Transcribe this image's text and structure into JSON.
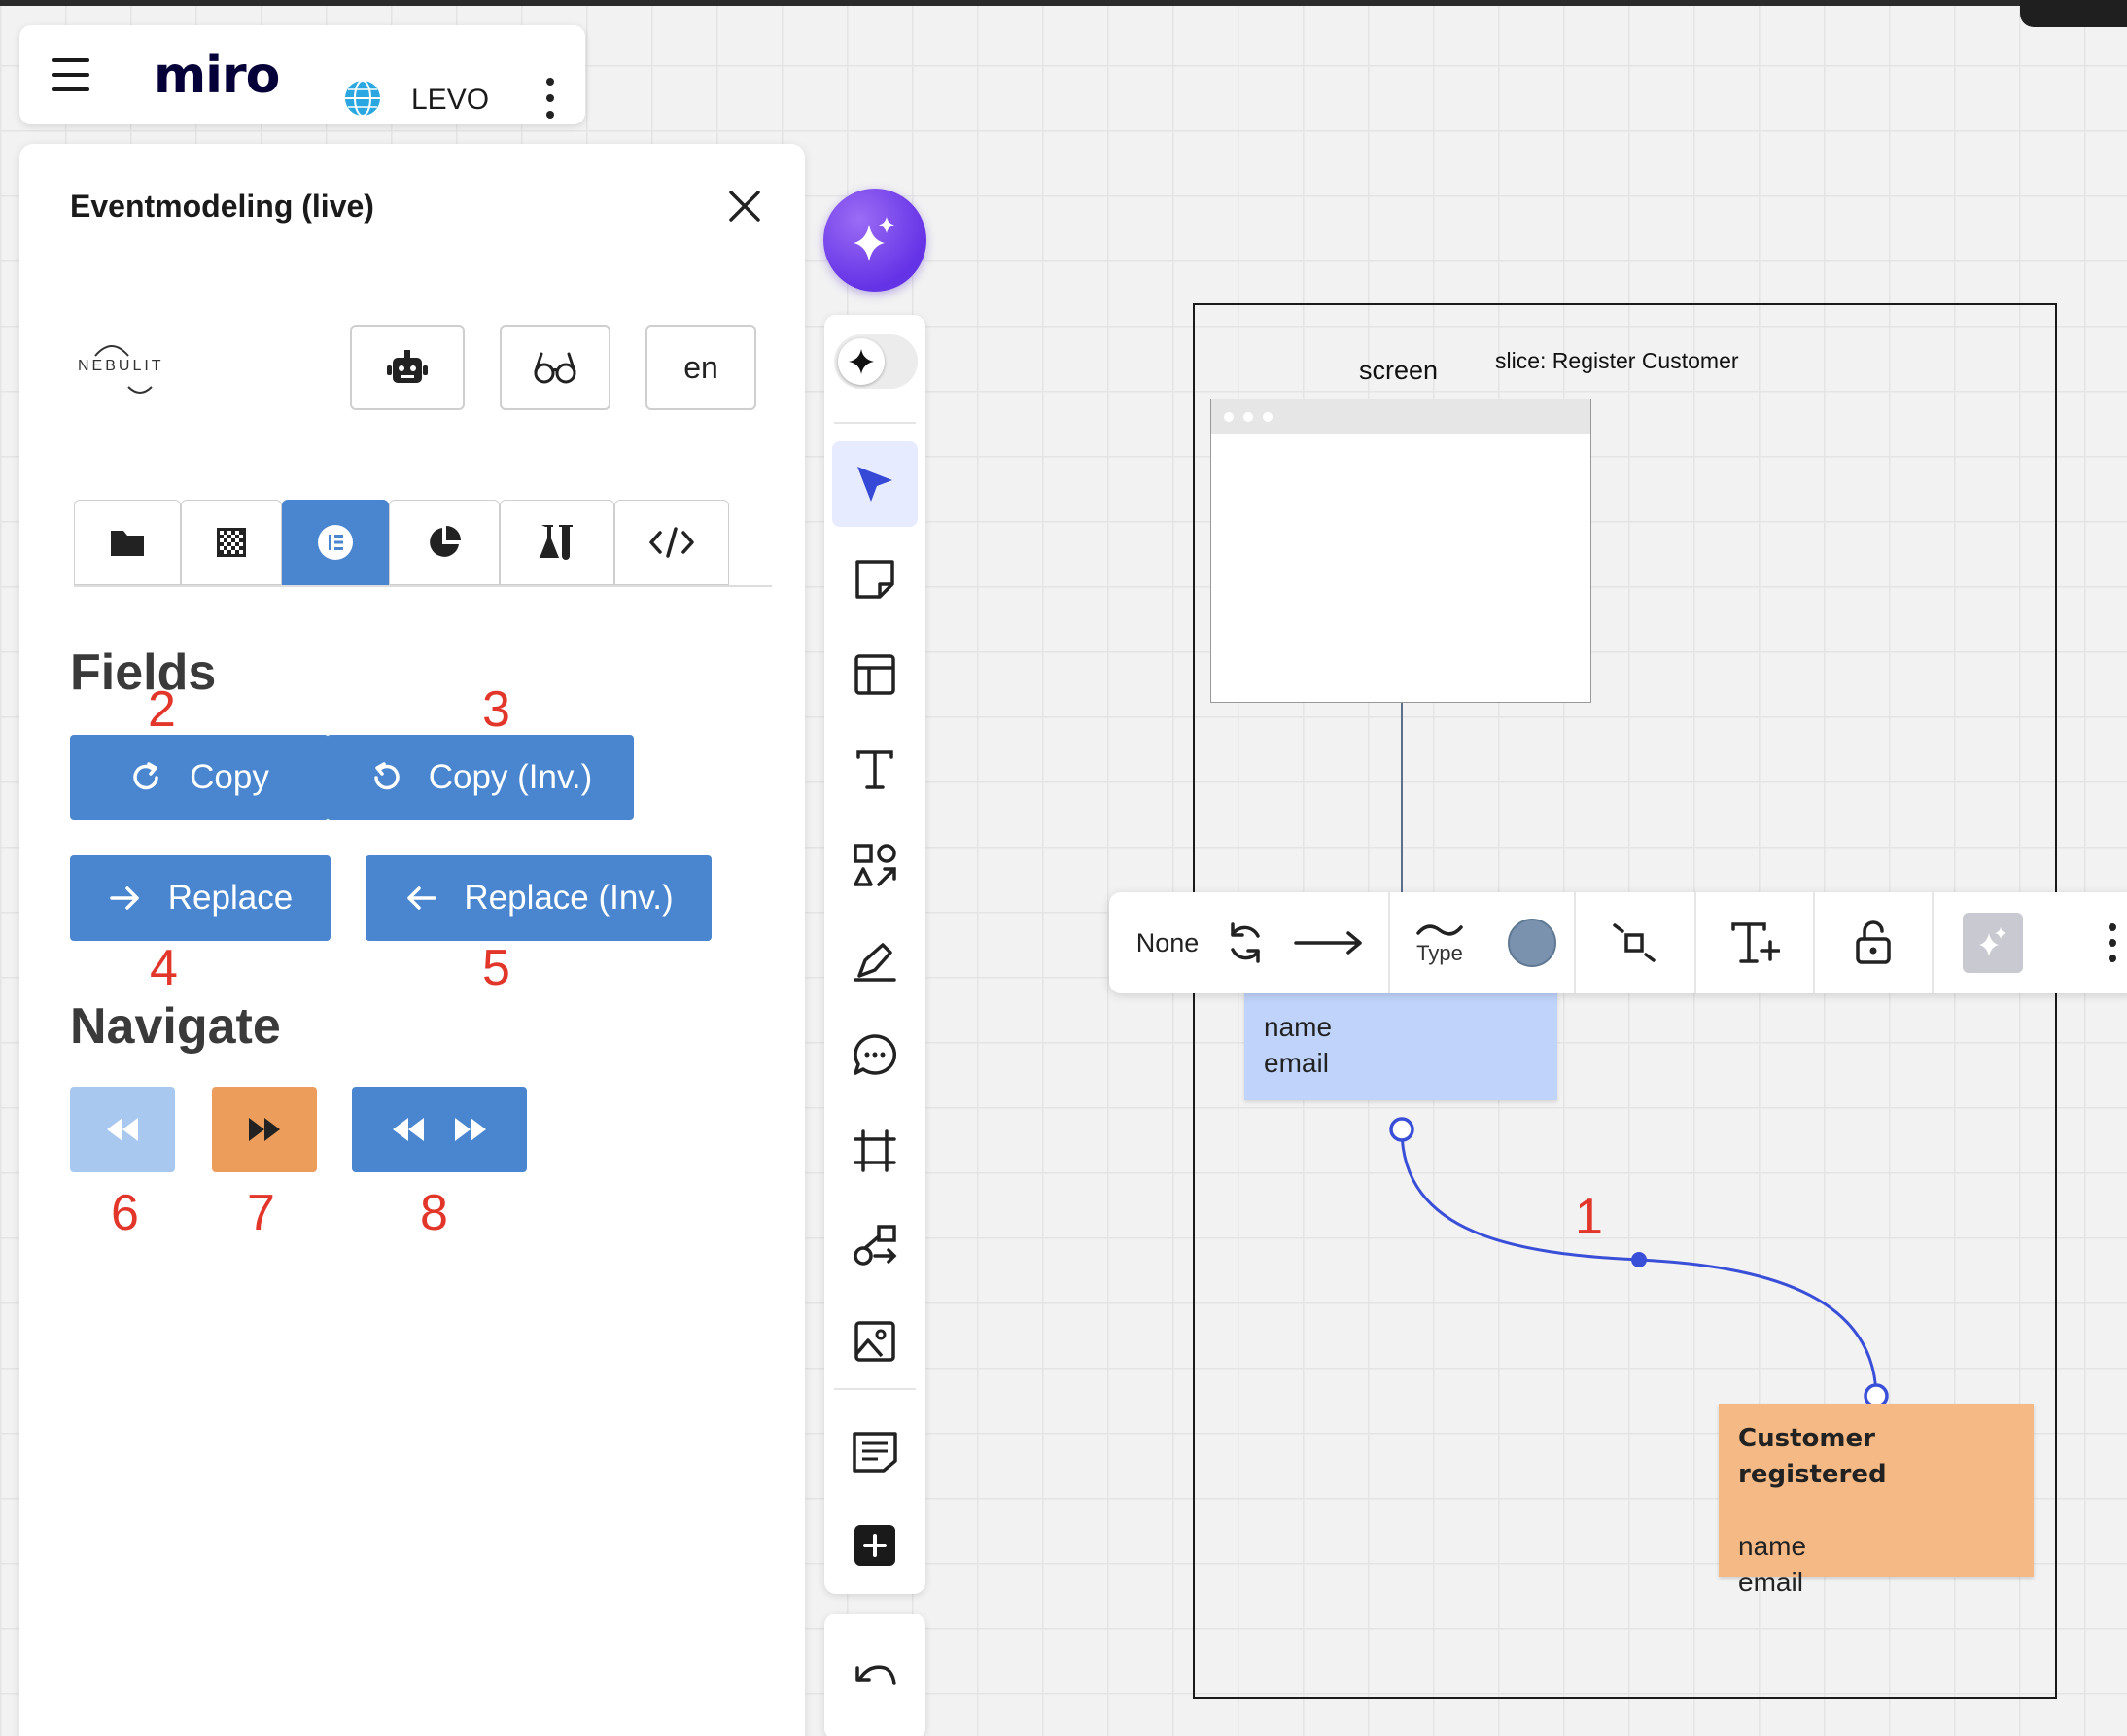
{
  "app": {
    "logo": "miro",
    "board_name": "LEVO"
  },
  "panel": {
    "title": "Eventmodeling (live)",
    "brand": "NEBULIT",
    "language": "en",
    "tabs": [
      "folder-icon",
      "checkerboard-icon",
      "list-icon",
      "pie-chart-icon",
      "flask-icon",
      "code-icon"
    ],
    "active_tab": "list-icon",
    "fields": {
      "heading": "Fields",
      "copy": "Copy",
      "copy_inv": "Copy (Inv.)",
      "replace": "Replace",
      "replace_inv": "Replace (Inv.)"
    },
    "navigate": {
      "heading": "Navigate"
    },
    "annotations": [
      "1",
      "2",
      "3",
      "4",
      "5",
      "6",
      "7",
      "8"
    ]
  },
  "colors": {
    "primary_blue": "#4a86d0",
    "light_blue": "#a9c8f0",
    "orange": "#ec9d5b",
    "annotation_red": "#e2362b",
    "ai_purple": "#6533e6",
    "sticky_blue": "#c0d4fb",
    "sticky_orange": "#f4b985",
    "connector_blue": "#3a4fd8"
  },
  "canvas": {
    "screen_label": "screen",
    "slice_label": "slice: Register Customer",
    "command_sticky": [
      "name",
      "email"
    ],
    "event_sticky": {
      "title": "Customer registered",
      "fields": [
        "name",
        "email"
      ]
    }
  },
  "context_toolbar": {
    "none_label": "None",
    "type_label": "Type"
  }
}
